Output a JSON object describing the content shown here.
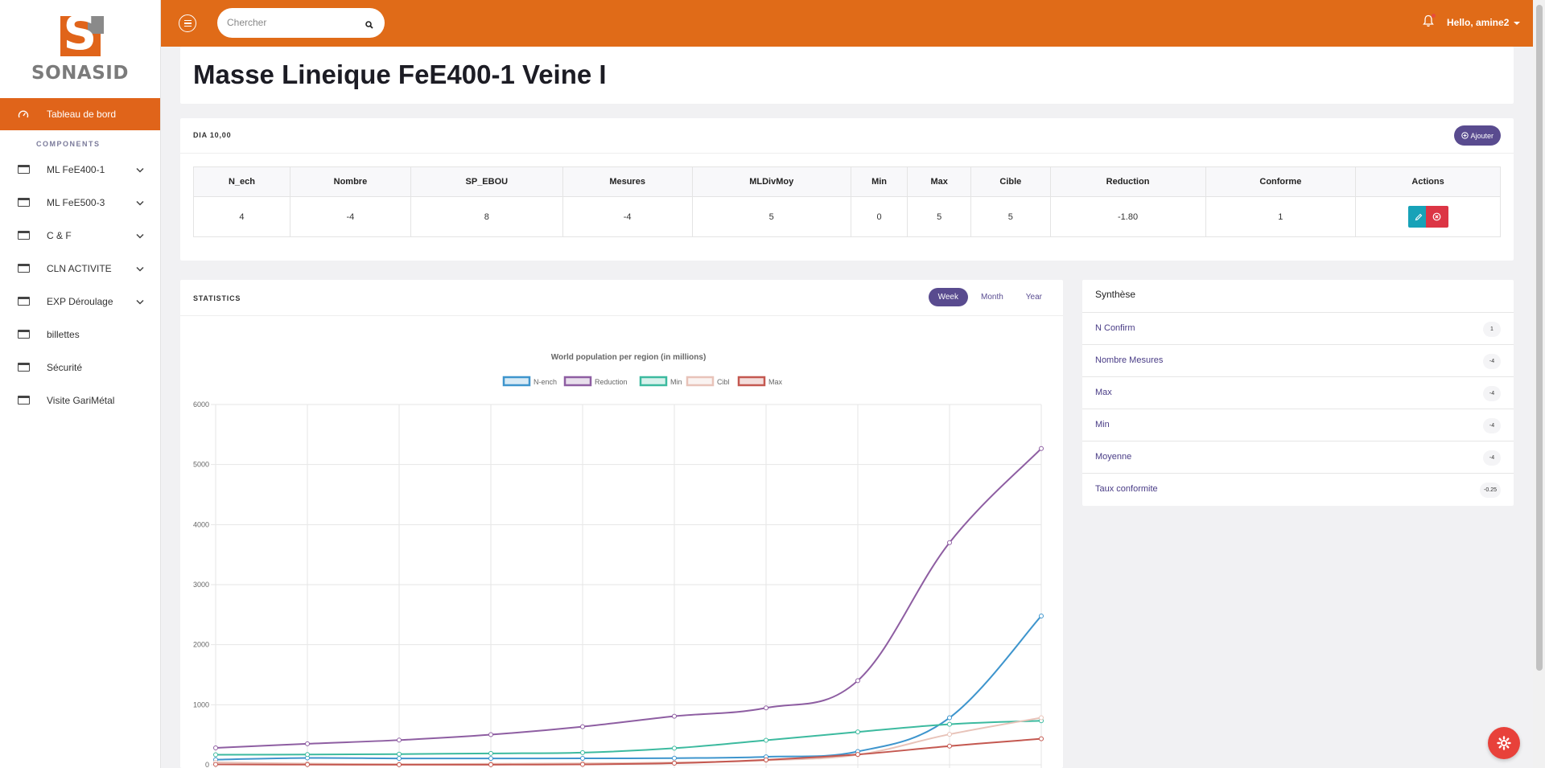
{
  "brand": {
    "name": "SONASID",
    "colors": {
      "primary": "#e06b18",
      "accent": "#594b8f",
      "danger": "#dc3545",
      "info": "#17a2b8"
    }
  },
  "sidebar": {
    "active": {
      "label": "Tableau de bord",
      "icon": "gauge-icon"
    },
    "section_label": "COMPONENTS",
    "items": [
      {
        "label": "ML FeE400-1",
        "icon": "window-icon",
        "expandable": true
      },
      {
        "label": "ML FeE500-3",
        "icon": "window-icon",
        "expandable": true
      },
      {
        "label": "C & F",
        "icon": "window-icon",
        "expandable": true
      },
      {
        "label": "CLN ACTIVITE",
        "icon": "window-icon",
        "expandable": true
      },
      {
        "label": "EXP Déroulage",
        "icon": "window-icon",
        "expandable": true
      },
      {
        "label": "billettes",
        "icon": "window-icon",
        "expandable": false
      },
      {
        "label": "Sécurité",
        "icon": "window-icon",
        "expandable": false
      },
      {
        "label": "Visite GariMétal",
        "icon": "window-icon",
        "expandable": false
      }
    ]
  },
  "topbar": {
    "search_placeholder": "Chercher",
    "search_value": "",
    "user_greeting": "Hello, amine2"
  },
  "page": {
    "title": "Masse Lineique FeE400-1 Veine I"
  },
  "table_card": {
    "heading": "DIA 10,00",
    "add_label": "Ajouter",
    "columns": [
      "N_ech",
      "Nombre",
      "SP_EBOU",
      "Mesures",
      "MLDivMoy",
      "Min",
      "Max",
      "Cible",
      "Reduction",
      "Conforme",
      "Actions"
    ],
    "rows": [
      [
        "4",
        "-4",
        "8",
        "-4",
        "5",
        "0",
        "5",
        "5",
        "-1.80",
        "1"
      ]
    ]
  },
  "stats": {
    "heading": "STATISTICS",
    "tabs": [
      {
        "label": "Week",
        "active": true
      },
      {
        "label": "Month",
        "active": false
      },
      {
        "label": "Year",
        "active": false
      }
    ]
  },
  "chart_data": {
    "type": "line",
    "title": "World population per region (in millions)",
    "ylim": [
      0,
      6000
    ],
    "yticks": [
      0,
      1000,
      2000,
      3000,
      4000,
      5000,
      6000
    ],
    "x_count": 10,
    "grid": true,
    "legend_position": "top",
    "series": [
      {
        "name": "N-ench",
        "color": "#3e95cd",
        "values": [
          86,
          114,
          106,
          106,
          107,
          111,
          133,
          221,
          783,
          2478
        ]
      },
      {
        "name": "Reduction",
        "color": "#8e5ea2",
        "values": [
          282,
          350,
          411,
          502,
          635,
          809,
          947,
          1402,
          3700,
          5267
        ]
      },
      {
        "name": "Min",
        "color": "#3cba9f",
        "values": [
          168,
          170,
          178,
          190,
          203,
          276,
          408,
          547,
          675,
          734
        ]
      },
      {
        "name": "Cibl",
        "color": "#e8c3b9",
        "values": [
          40,
          20,
          10,
          16,
          24,
          38,
          74,
          167,
          508,
          784
        ]
      },
      {
        "name": "Max",
        "color": "#c45850",
        "values": [
          6,
          3,
          2,
          2,
          7,
          26,
          82,
          172,
          312,
          433
        ]
      }
    ]
  },
  "synthese": {
    "title": "Synthèse",
    "rows": [
      {
        "label": "N Confirm",
        "value": "1"
      },
      {
        "label": "Nombre Mesures",
        "value": "-4"
      },
      {
        "label": "Max",
        "value": "-4"
      },
      {
        "label": "Min",
        "value": "-4"
      },
      {
        "label": "Moyenne",
        "value": "-4"
      },
      {
        "label": "Taux conformite",
        "value": "-0.25"
      }
    ]
  }
}
